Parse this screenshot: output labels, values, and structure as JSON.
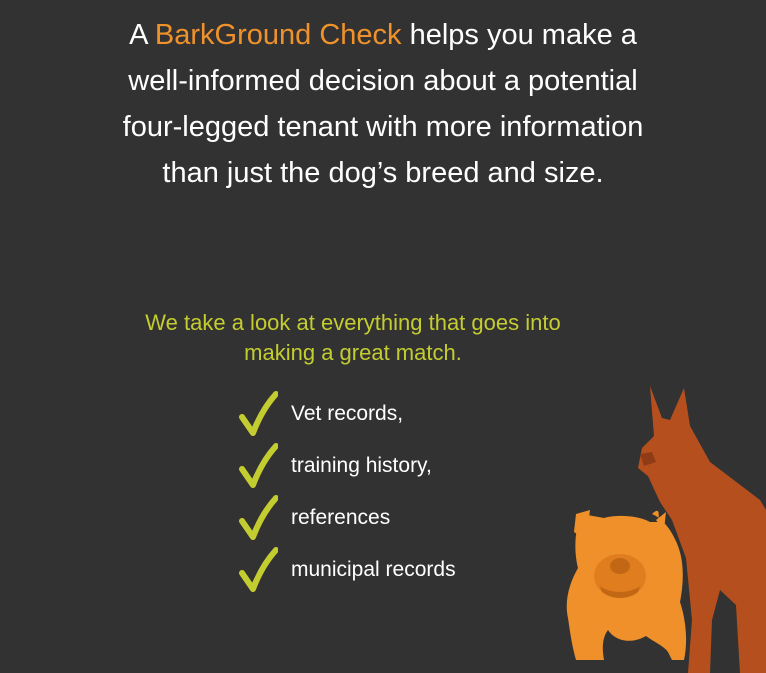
{
  "intro": {
    "prefix": "A ",
    "brand": "BarkGround Check",
    "line1_rest": " helps you make a",
    "line2": "well-informed decision about a potential",
    "line3": "four-legged tenant with more information",
    "line4": "than just the dog’s breed and size."
  },
  "tagline": {
    "line1": "We take a look at everything that goes into",
    "line2": "making a great match."
  },
  "checklist": [
    {
      "label": "Vet records,",
      "icon": "checkmark-icon"
    },
    {
      "label": "training history,",
      "icon": "checkmark-icon"
    },
    {
      "label": "references",
      "icon": "checkmark-icon"
    },
    {
      "label": "municipal records",
      "icon": "checkmark-icon"
    }
  ],
  "colors": {
    "background": "#333232",
    "brand_orange": "#f0922b",
    "accent_green": "#c4cd2f",
    "doberman": "#b5501e",
    "bulldog": "#f0902a"
  }
}
